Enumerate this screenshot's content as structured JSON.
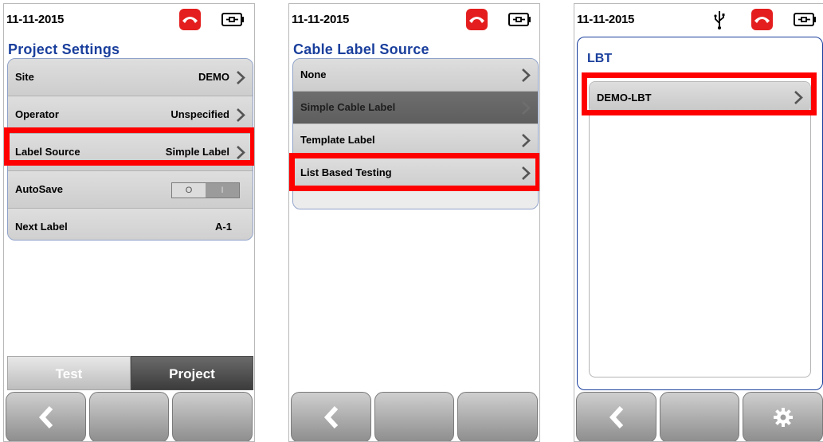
{
  "colors": {
    "title": "#1a3f9c",
    "highlight": "#ff0000",
    "phone": "#e41e1e"
  },
  "screen1": {
    "status": {
      "date": "11-11-2015",
      "icons": [
        "phone-hangup-icon",
        "battery-plug-icon"
      ]
    },
    "title": "Project Settings",
    "rows": [
      {
        "label": "Site",
        "value": "DEMO",
        "chevron": true
      },
      {
        "label": "Operator",
        "value": "Unspecified",
        "chevron": true
      },
      {
        "label": "Label Source",
        "value": "Simple Label",
        "chevron": true,
        "highlighted": true
      },
      {
        "label": "AutoSave",
        "toggle": {
          "on": "O",
          "off": "I"
        }
      },
      {
        "label": "Next Label",
        "value": "A-1"
      }
    ],
    "tabs": [
      "Test",
      "Project"
    ],
    "active_tab": "Project",
    "buttons": [
      "back-icon",
      "",
      ""
    ]
  },
  "screen2": {
    "status": {
      "date": "11-11-2015",
      "icons": [
        "phone-hangup-icon",
        "battery-plug-icon"
      ]
    },
    "title": "Cable Label Source",
    "rows": [
      {
        "label": "None"
      },
      {
        "label": "Simple Cable Label",
        "selected": true
      },
      {
        "label": "Template Label"
      },
      {
        "label": "List Based Testing",
        "highlighted": true
      }
    ],
    "buttons": [
      "back-icon",
      "",
      ""
    ]
  },
  "screen3": {
    "status": {
      "date": "11-11-2015",
      "icons": [
        "usb-icon",
        "phone-hangup-icon",
        "battery-plug-icon"
      ]
    },
    "title": "LBT",
    "rows": [
      {
        "label": "DEMO-LBT",
        "highlighted": true
      }
    ],
    "buttons": [
      "back-icon",
      "",
      "gear-icon"
    ]
  }
}
